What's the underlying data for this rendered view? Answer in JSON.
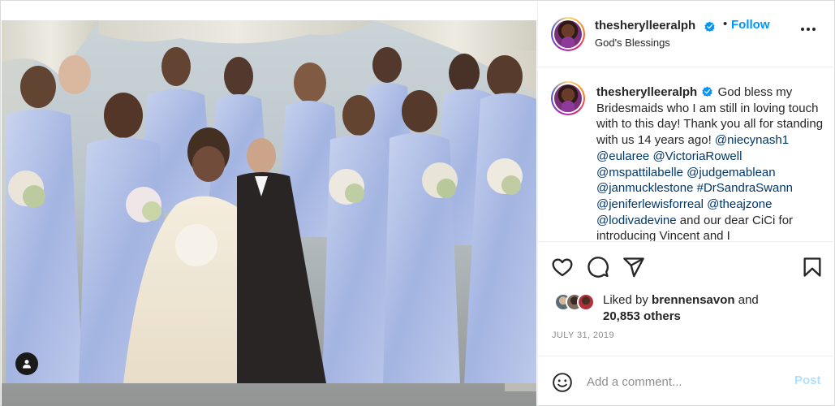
{
  "post": {
    "photo_alt": "",
    "header": {
      "username": "thesherylleeralph",
      "separator": "•",
      "follow_label": "Follow",
      "location": "God's Blessings"
    },
    "caption": {
      "username": "thesherylleeralph",
      "text_1": "God bless my Bridesmaids who I am still in loving touch with to this day! Thank you all for standing with us 14 years ago!",
      "mentions": [
        "@niecynash1",
        "@eularee",
        "@VictoriaRowell",
        "@mspattilabelle",
        "@judgemablean",
        "@janmucklestone",
        "#DrSandraSwann",
        "@jeniferlewisforreal",
        "@theajzone",
        "@lodivadevine"
      ],
      "text_2": "and our dear CiCi for introducing Vincent and I"
    },
    "likes": {
      "prefix": "Liked by",
      "user": "brennensavon",
      "conj": "and",
      "others": "20,853 others"
    },
    "date": "JULY 31, 2019",
    "comment": {
      "placeholder": "Add a comment...",
      "post_label": "Post"
    }
  },
  "icons": {
    "verified": "verified-badge-icon",
    "more": "more-options-icon",
    "like": "heart-icon",
    "comment": "comment-icon",
    "share": "share-icon",
    "save": "bookmark-icon",
    "emoji": "emoji-icon",
    "tag": "user-tag-icon"
  },
  "colors": {
    "accent": "#0095f6",
    "verified": "#0095f6",
    "mention": "#00376b",
    "muted": "#8e8e8e",
    "post_disabled": "#b2dffc",
    "bridesmaid_dress": "#a8b8e0"
  }
}
